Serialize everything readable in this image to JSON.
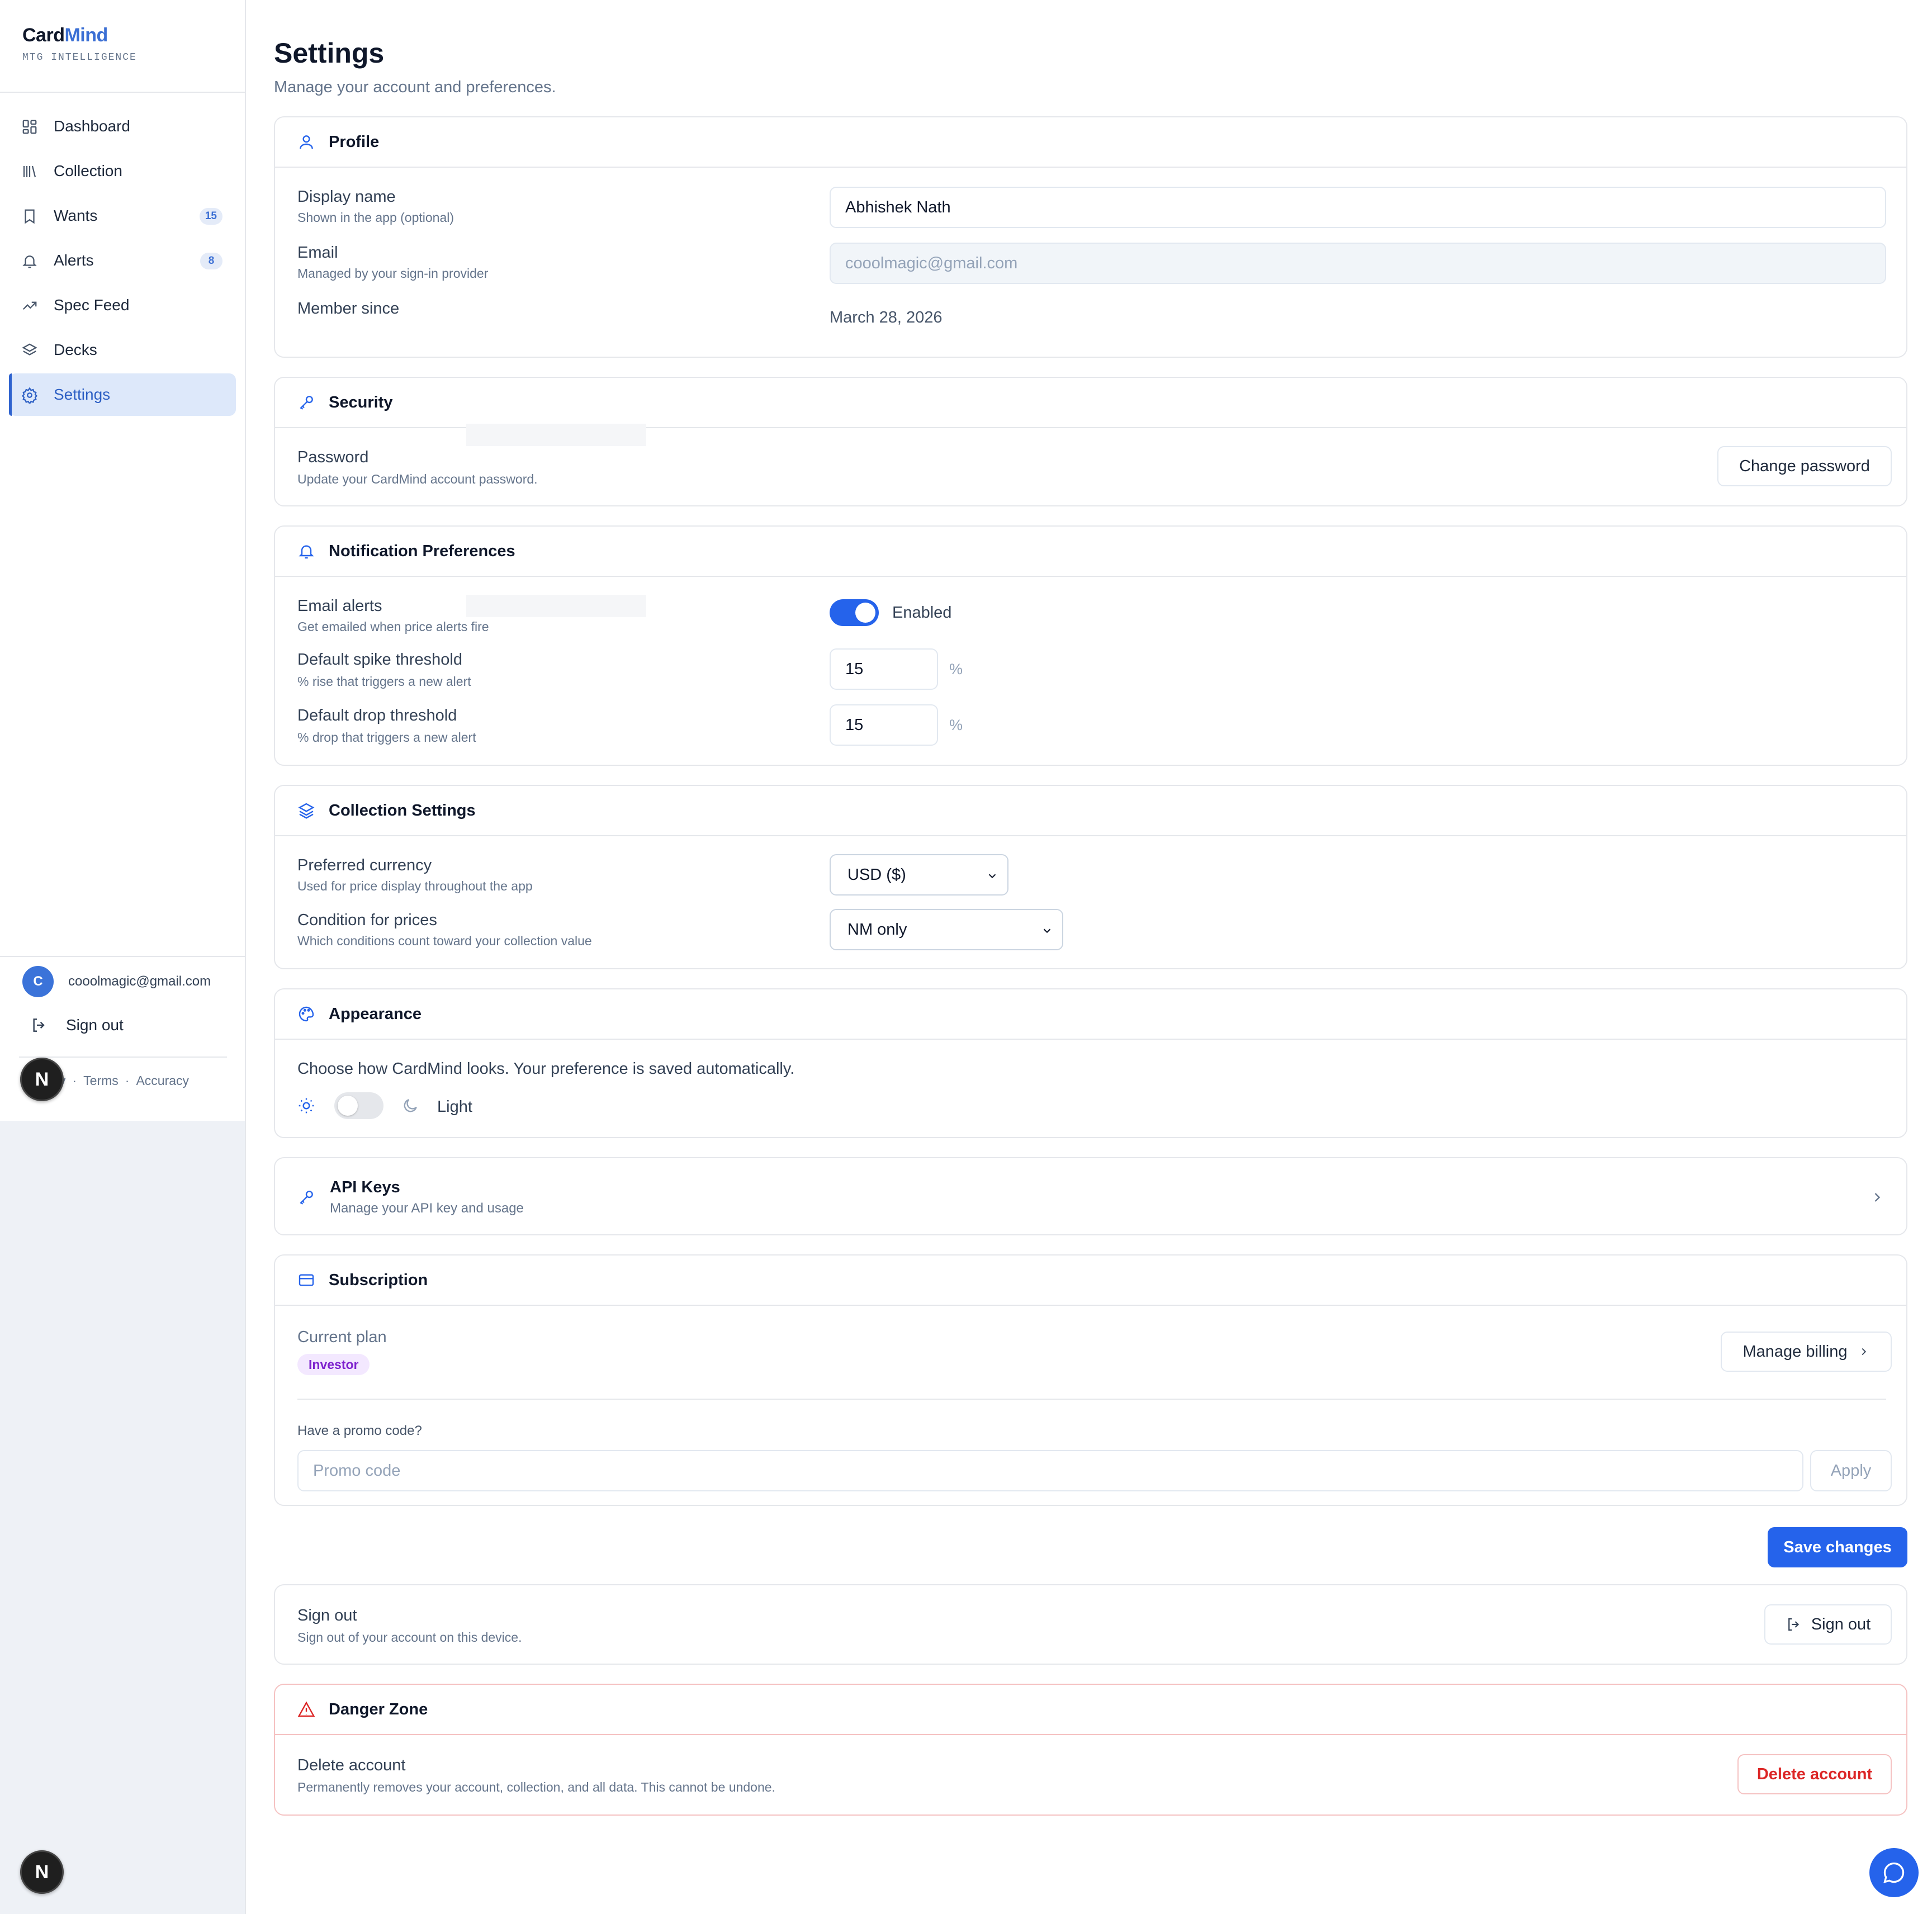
{
  "app": {
    "name_part1": "Card",
    "name_part2": "Mind",
    "tagline": "MTG INTELLIGENCE"
  },
  "sidebar": {
    "items": [
      {
        "label": "Dashboard",
        "icon": "dashboard-icon"
      },
      {
        "label": "Collection",
        "icon": "library-icon"
      },
      {
        "label": "Wants",
        "icon": "bookmark-icon",
        "badge": "15"
      },
      {
        "label": "Alerts",
        "icon": "bell-icon",
        "badge": "8"
      },
      {
        "label": "Spec Feed",
        "icon": "trending-up-icon"
      },
      {
        "label": "Decks",
        "icon": "layers-icon"
      },
      {
        "label": "Settings",
        "icon": "gear-icon",
        "active": true
      }
    ],
    "user_initial": "C",
    "user_email": "cooolmagic@gmail.com",
    "sign_out": "Sign out",
    "footer": {
      "privacy_fragment": "y",
      "terms": "Terms",
      "accuracy": "Accuracy",
      "separator": "·"
    }
  },
  "floating": {
    "n_label": "N"
  },
  "page": {
    "title": "Settings",
    "subtitle": "Manage your account and preferences."
  },
  "profile": {
    "title": "Profile",
    "display_name_label": "Display name",
    "display_name_hint": "Shown in the app (optional)",
    "display_name_value": "Abhishek Nath",
    "email_label": "Email",
    "email_hint": "Managed by your sign-in provider",
    "email_value": "cooolmagic@gmail.com",
    "member_since_label": "Member since",
    "member_since_value": "March 28, 2026"
  },
  "security": {
    "title": "Security",
    "password_label": "Password",
    "password_hint": "Update your CardMind account password.",
    "change_password": "Change password"
  },
  "notifications": {
    "title": "Notification Preferences",
    "email_alerts_label": "Email alerts",
    "email_alerts_hint": "Get emailed when price alerts fire",
    "email_alerts_state": "Enabled",
    "email_alerts_on": true,
    "spike_label": "Default spike threshold",
    "spike_hint": "% rise that triggers a new alert",
    "spike_value": "15",
    "drop_label": "Default drop threshold",
    "drop_hint": "% drop that triggers a new alert",
    "drop_value": "15",
    "pct_symbol": "%"
  },
  "collection": {
    "title": "Collection Settings",
    "currency_label": "Preferred currency",
    "currency_hint": "Used for price display throughout the app",
    "currency_value": "USD ($)",
    "condition_label": "Condition for prices",
    "condition_hint": "Which conditions count toward your collection value",
    "condition_value": "NM only"
  },
  "appearance": {
    "title": "Appearance",
    "description": "Choose how CardMind looks. Your preference is saved automatically.",
    "theme_label": "Light",
    "dark_mode_on": false
  },
  "api_keys": {
    "title": "API Keys",
    "subtitle": "Manage your API key and usage"
  },
  "subscription": {
    "title": "Subscription",
    "current_plan_label": "Current plan",
    "plan_name": "Investor",
    "manage_billing": "Manage billing",
    "promo_label": "Have a promo code?",
    "promo_placeholder": "Promo code",
    "apply": "Apply"
  },
  "save_changes": "Save changes",
  "sign_out_card": {
    "title": "Sign out",
    "hint": "Sign out of your account on this device.",
    "button": "Sign out"
  },
  "danger": {
    "title": "Danger Zone",
    "delete_label": "Delete account",
    "delete_hint": "Permanently removes your account, collection, and all data. This cannot be undone.",
    "delete_button": "Delete account"
  },
  "colors": {
    "accent": "#2563eb",
    "brand": "#3b6fd4",
    "danger": "#dc2626",
    "plan_badge_bg": "#f3e8ff",
    "plan_badge_text": "#7e22ce"
  }
}
